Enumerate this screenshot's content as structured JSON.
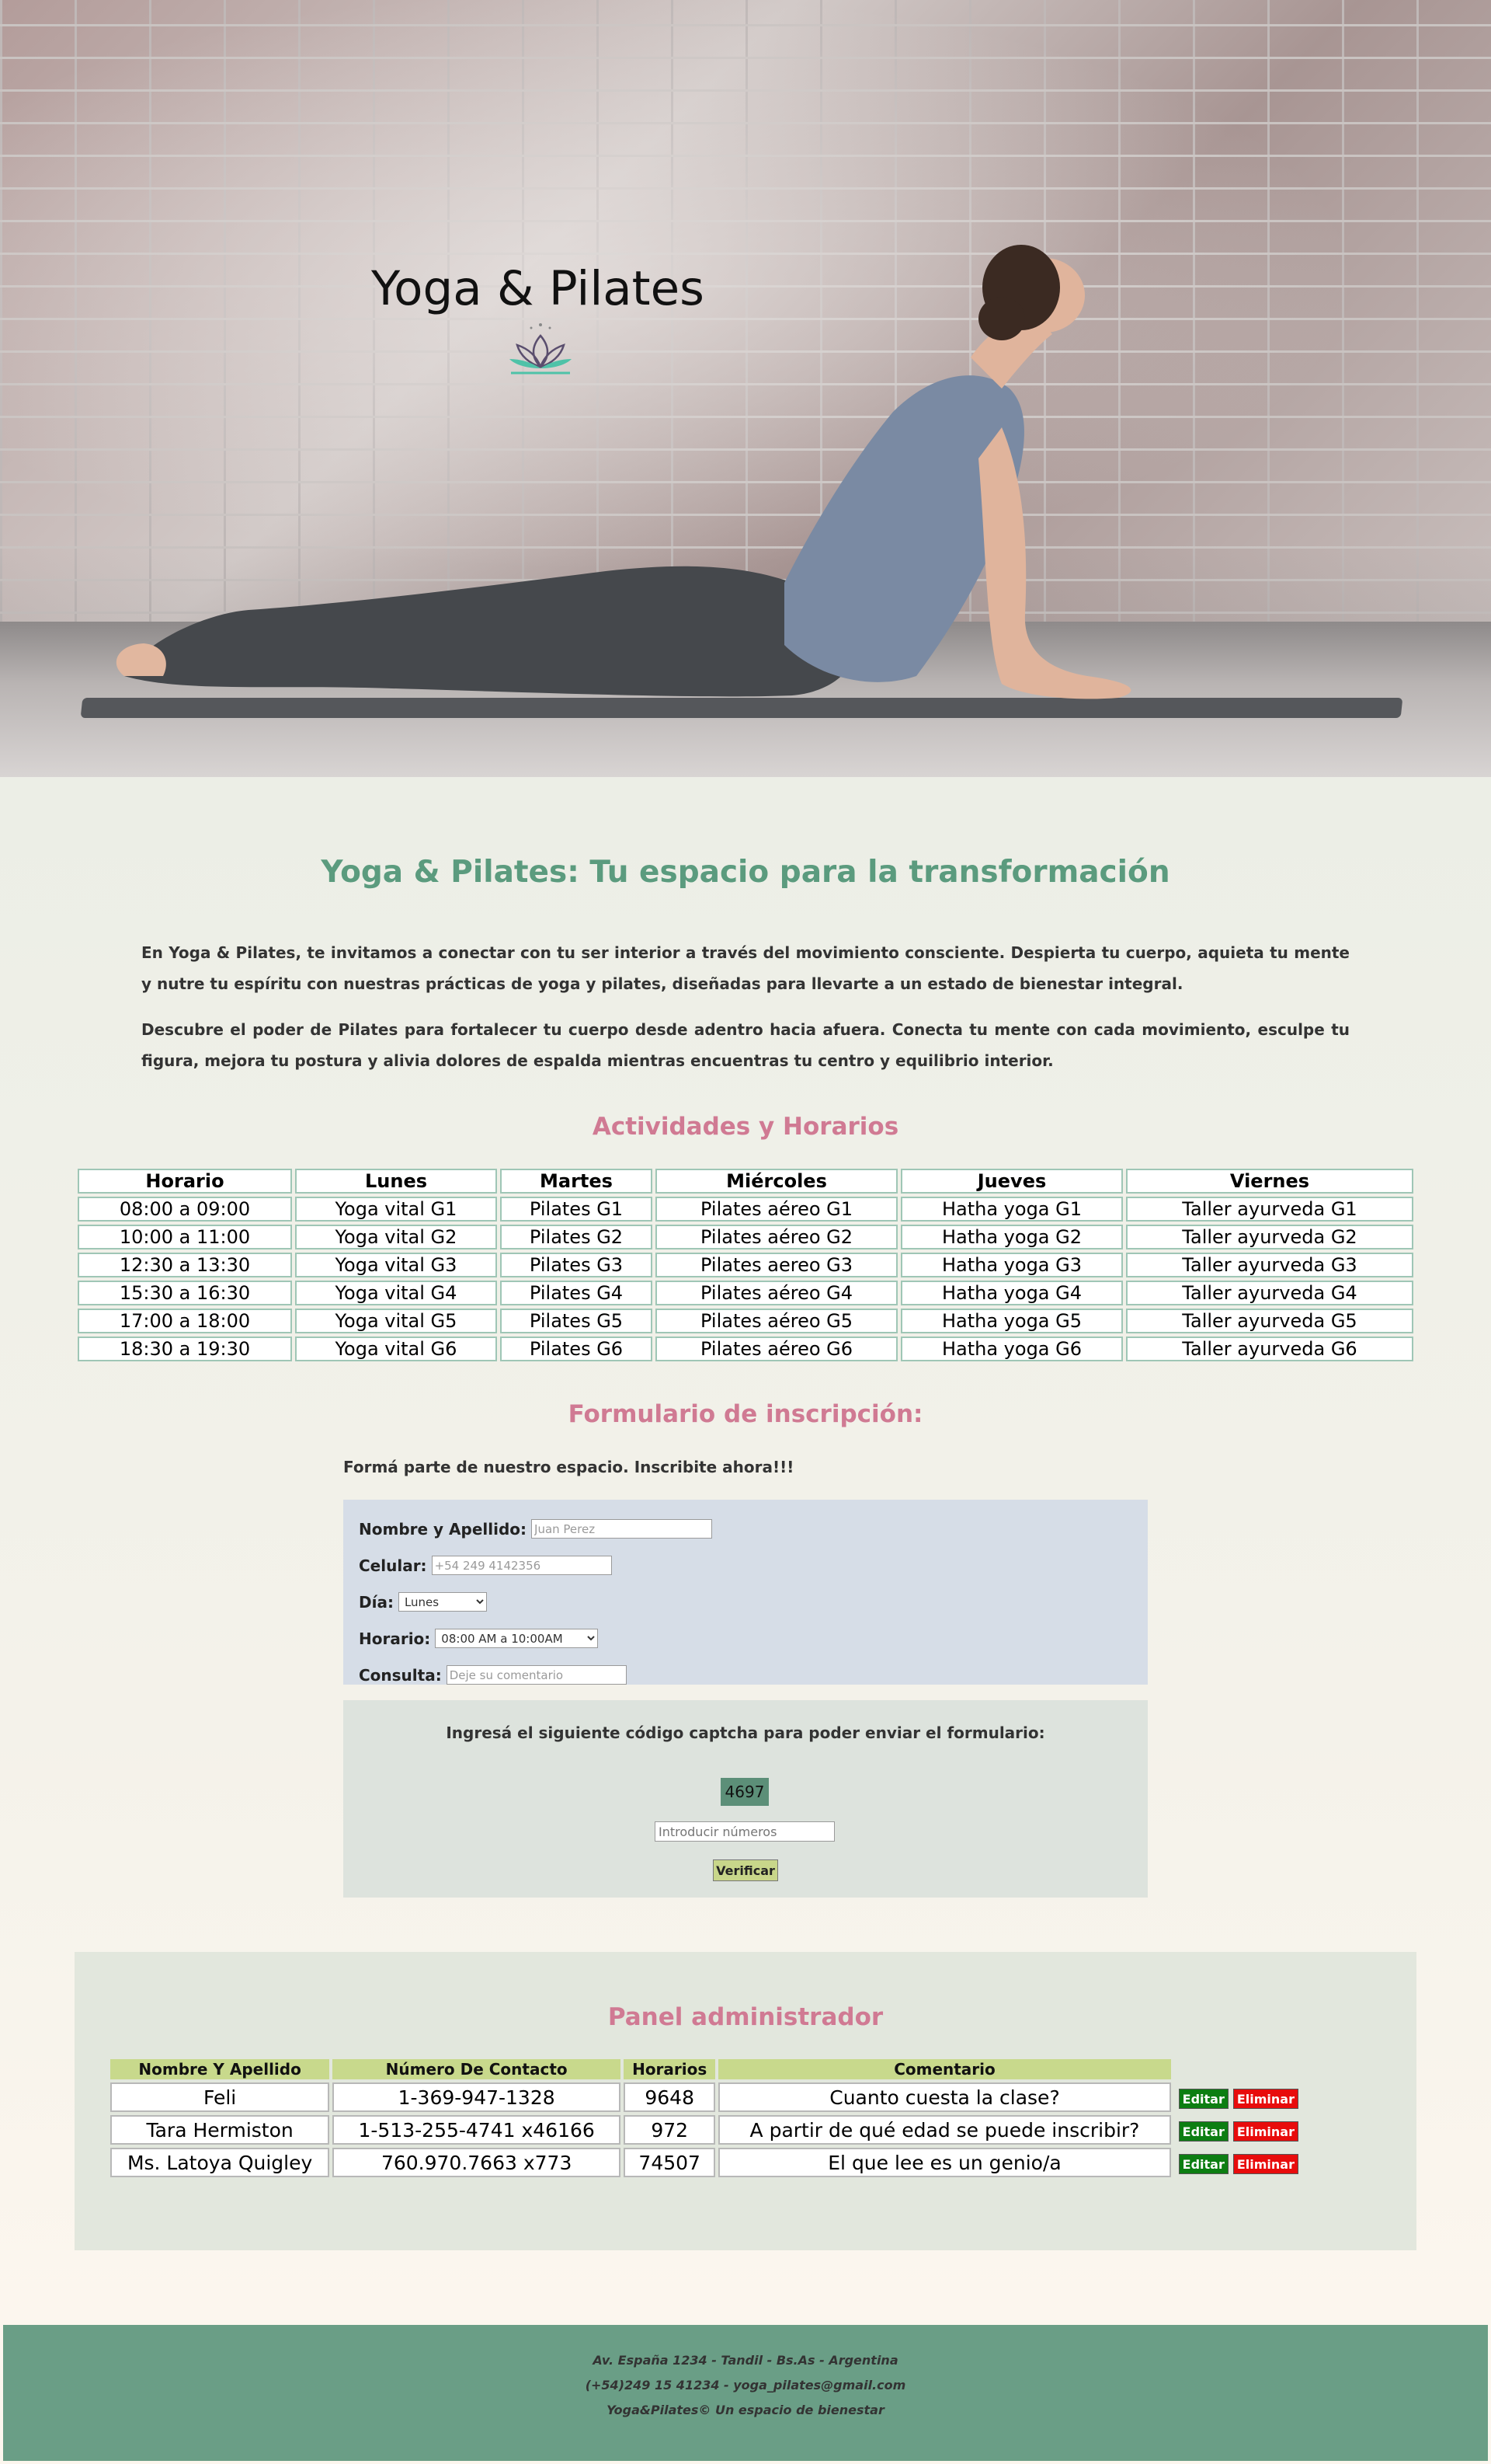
{
  "hero": {
    "title": "Yoga & Pilates"
  },
  "intro": {
    "title": "Yoga & Pilates: Tu espacio para la transformación",
    "paragraph1": "En Yoga & Pilates, te invitamos a conectar con tu ser interior a través del movimiento consciente. Despierta tu cuerpo, aquieta tu mente y nutre tu espíritu con nuestras prácticas de yoga y pilates, diseñadas para llevarte a un estado de bienestar integral.",
    "paragraph2": "Descubre el poder de Pilates para fortalecer tu cuerpo desde adentro hacia afuera. Conecta tu mente con cada movimiento, esculpe tu figura, mejora tu postura y alivia dolores de espalda mientras encuentras tu centro y equilibrio interior."
  },
  "schedule": {
    "title": "Actividades y Horarios",
    "headers": [
      "Horario",
      "Lunes",
      "Martes",
      "Miércoles",
      "Jueves",
      "Viernes"
    ],
    "rows": [
      [
        "08:00 a 09:00",
        "Yoga vital G1",
        "Pilates G1",
        "Pilates aéreo G1",
        "Hatha yoga G1",
        "Taller ayurveda G1"
      ],
      [
        "10:00 a 11:00",
        "Yoga vital G2",
        "Pilates G2",
        "Pilates aéreo G2",
        "Hatha yoga G2",
        "Taller ayurveda G2"
      ],
      [
        "12:30 a 13:30",
        "Yoga vital G3",
        "Pilates G3",
        "Pilates aereo G3",
        "Hatha yoga G3",
        "Taller ayurveda G3"
      ],
      [
        "15:30 a 16:30",
        "Yoga vital G4",
        "Pilates G4",
        "Pilates aéreo G4",
        "Hatha yoga G4",
        "Taller ayurveda G4"
      ],
      [
        "17:00 a 18:00",
        "Yoga vital G5",
        "Pilates G5",
        "Pilates aéreo G5",
        "Hatha yoga G5",
        "Taller ayurveda G5"
      ],
      [
        "18:30 a 19:30",
        "Yoga vital G6",
        "Pilates G6",
        "Pilates aéreo G6",
        "Hatha yoga G6",
        "Taller ayurveda G6"
      ]
    ]
  },
  "form": {
    "title": "Formulario de inscripción:",
    "intro": "Formá parte de nuestro espacio. Inscribite ahora!!!",
    "name_label": "Nombre y Apellido:",
    "name_placeholder": "Juan Perez",
    "phone_label": "Celular:",
    "phone_placeholder": "+54 249 4142356",
    "day_label": "Día:",
    "day_value": "Lunes",
    "time_label": "Horario:",
    "time_value": "08:00 AM a 10:00AM",
    "comment_label": "Consulta:",
    "comment_placeholder": "Deje su comentario"
  },
  "captcha": {
    "text": "Ingresá el siguiente código captcha para poder enviar el formulario:",
    "code": "4697",
    "input_placeholder": "Introducir números",
    "verify_label": "Verificar"
  },
  "admin": {
    "title": "Panel administrador",
    "headers": [
      "Nombre Y Apellido",
      "Número De Contacto",
      "Horarios",
      "Comentario"
    ],
    "edit_label": "Editar",
    "delete_label": "Eliminar",
    "rows": [
      [
        "Feli",
        "1-369-947-1328",
        "9648",
        "Cuanto cuesta la clase?"
      ],
      [
        "Tara Hermiston",
        "1-513-255-4741 x46166",
        "972",
        "A partir de qué edad se puede inscribir?"
      ],
      [
        "Ms. Latoya Quigley",
        "760.970.7663 x773",
        "74507",
        "El que lee es un genio/a"
      ]
    ]
  },
  "footer": {
    "address": "Av. España 1234 - Tandil - Bs.As - Argentina",
    "contact": "(+54)249 15 41234 - yoga_pilates@gmail.com",
    "copyright": "Yoga&Pilates© Un espacio de bienestar"
  },
  "colors": {
    "title_green": "#5b9b7e",
    "section_pink": "#d07a93",
    "footer_green": "#6a9e86",
    "edit_green": "#0c7e12",
    "delete_red": "#e80c0c"
  }
}
